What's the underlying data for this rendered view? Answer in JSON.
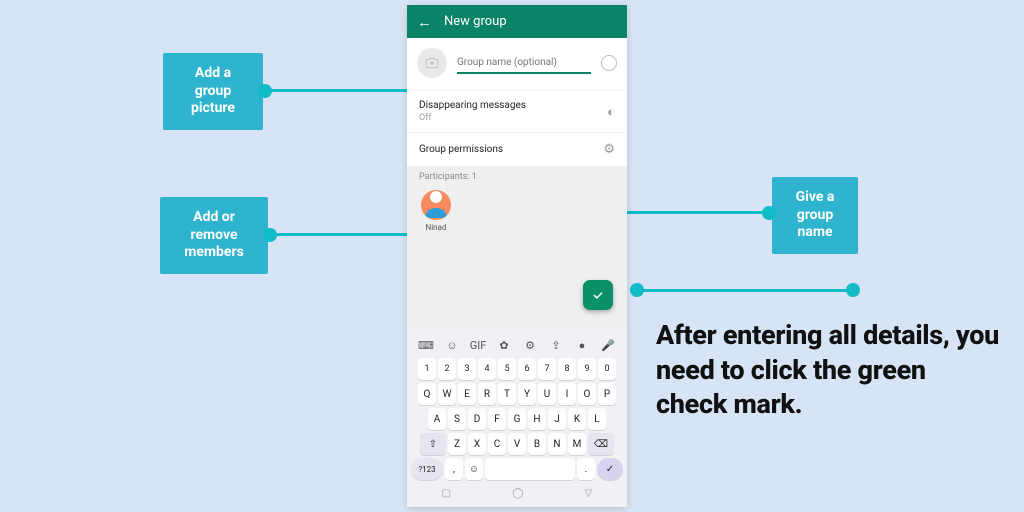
{
  "callouts": {
    "picture": "Add a group picture",
    "members": "Add or remove members",
    "name": "Give a group name"
  },
  "appbar": {
    "title": "New group"
  },
  "group_name": {
    "placeholder": "Group name (optional)"
  },
  "settings": {
    "disappearing_label": "Disappearing messages",
    "disappearing_value": "Off",
    "permissions_label": "Group permissions"
  },
  "participants": {
    "header": "Participants: 1",
    "list": [
      {
        "name": "Ninad"
      }
    ]
  },
  "keyboard": {
    "toolbar": [
      "⌨",
      "☺",
      "GIF",
      "✿",
      "⚙",
      "⇪",
      "●",
      "🎤"
    ],
    "row_num": [
      "1",
      "2",
      "3",
      "4",
      "5",
      "6",
      "7",
      "8",
      "9",
      "0"
    ],
    "row1": [
      "Q",
      "W",
      "E",
      "R",
      "T",
      "Y",
      "U",
      "I",
      "O",
      "P"
    ],
    "row2": [
      "A",
      "S",
      "D",
      "F",
      "G",
      "H",
      "J",
      "K",
      "L"
    ],
    "row3_shift": "⇧",
    "row3": [
      "Z",
      "X",
      "C",
      "V",
      "B",
      "N",
      "M"
    ],
    "row3_bksp": "⌫",
    "row4_sym": "?123",
    "row4_comma": ",",
    "row4_emoji": "☺",
    "row4_period": ".",
    "row4_enter": "✓"
  },
  "nav": {
    "square": "▢",
    "circle": "◯",
    "tri": "▽"
  },
  "instruction": "After entering all details, you need to click the green check mark."
}
